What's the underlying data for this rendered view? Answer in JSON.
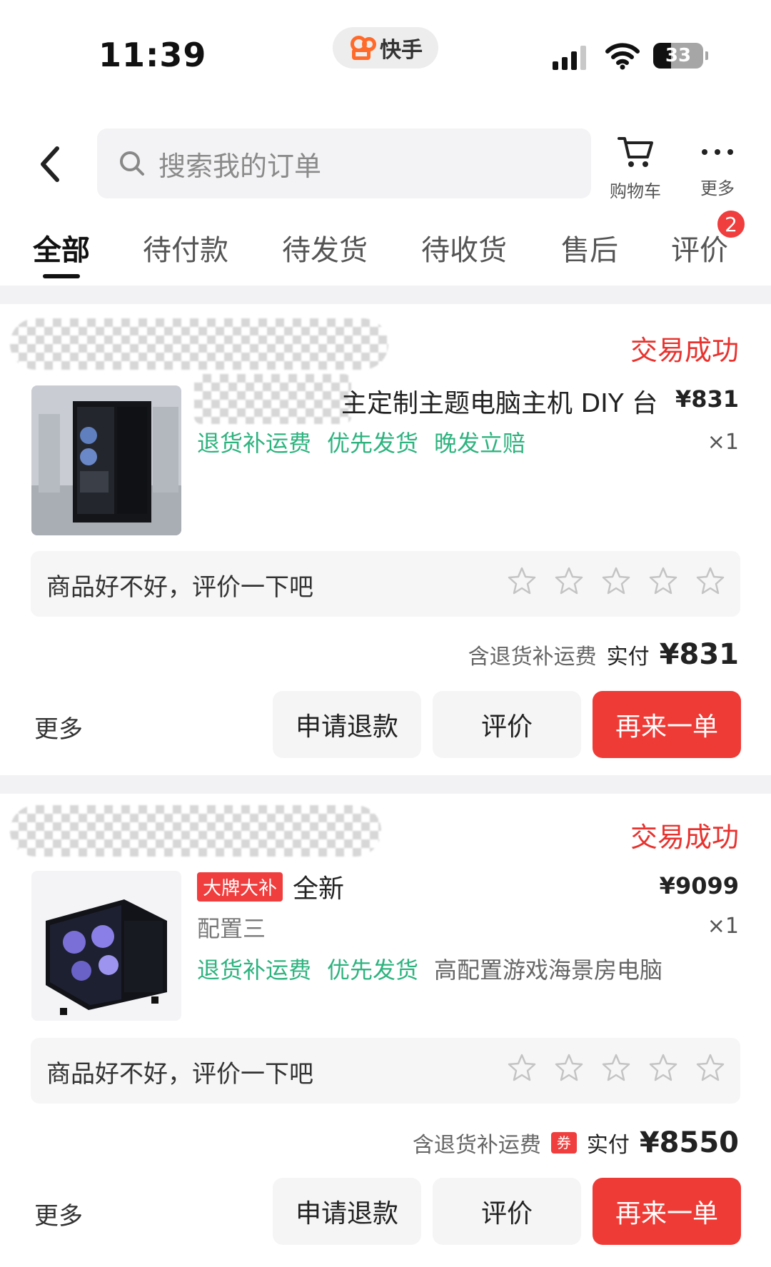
{
  "status_bar": {
    "time": "11:39",
    "app_name": "快手",
    "battery": "33"
  },
  "nav": {
    "search_placeholder": "搜索我的订单",
    "cart_label": "购物车",
    "more_label": "更多"
  },
  "tabs": [
    {
      "label": "全部",
      "active": true
    },
    {
      "label": "待付款"
    },
    {
      "label": "待发货"
    },
    {
      "label": "待收货"
    },
    {
      "label": "售后"
    },
    {
      "label": "评价",
      "badge": "2"
    }
  ],
  "orders": [
    {
      "status": "交易成功",
      "title": "主定制主题电脑主机 DIY 台",
      "price": "¥831",
      "qty": "×1",
      "tags": [
        "退货补运费",
        "优先发货",
        "晚发立赔"
      ],
      "rate_prompt": "商品好不好，评价一下吧",
      "stars": 5,
      "includes": "含退货补运费",
      "paid_label": "实付",
      "paid_amount": "¥831",
      "more": "更多",
      "btn_refund": "申请退款",
      "btn_review": "评价",
      "btn_again": "再来一单"
    },
    {
      "status": "交易成功",
      "promo": "大牌大补",
      "title": "全新",
      "spec": "配置三",
      "price": "¥9099",
      "qty": "×1",
      "tags": [
        "退货补运费",
        "优先发货"
      ],
      "tag_extra": "高配置游戏海景房电脑",
      "rate_prompt": "商品好不好，评价一下吧",
      "stars": 5,
      "includes": "含退货补运费",
      "coupon": "券",
      "paid_label": "实付",
      "paid_amount": "¥8550",
      "more": "更多",
      "btn_refund": "申请退款",
      "btn_review": "评价",
      "btn_again": "再来一单"
    }
  ],
  "colors": {
    "accent_red": "#ef3b36",
    "tag_green": "#2eb37f",
    "badge_red": "#f03d3d"
  }
}
